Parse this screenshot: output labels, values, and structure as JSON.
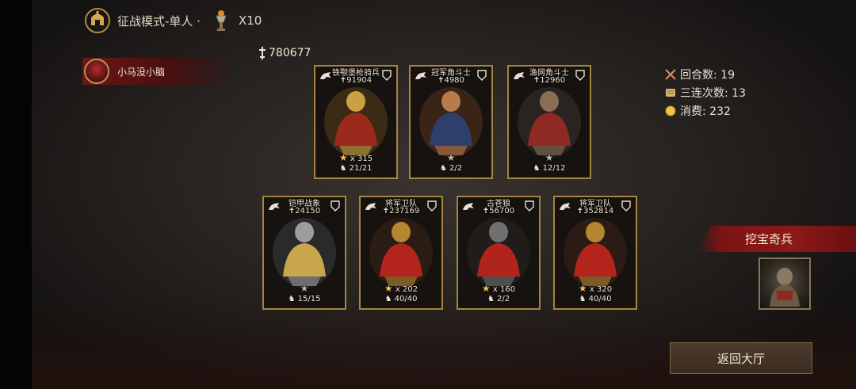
{
  "header": {
    "mode_label": "征战模式-单人 ·",
    "multiplier": "X10"
  },
  "player": {
    "name": "小马没小脑"
  },
  "total_power": "780677",
  "stats": {
    "rounds": "回合数: 19",
    "triple": "三连次数: 13",
    "cost": "消费: 232"
  },
  "cards": [
    {
      "name": "铁颚堡枪骑兵",
      "power": "91904",
      "stars": "x 315",
      "star_color": "gold",
      "troops": "21/21"
    },
    {
      "name": "冠军角斗士",
      "power": "4980",
      "stars": "",
      "star_color": "grey",
      "troops": "2/2"
    },
    {
      "name": "渔网角斗士",
      "power": "12960",
      "stars": "",
      "star_color": "grey",
      "troops": "12/12"
    },
    {
      "name": "铠甲战象",
      "power": "24150",
      "stars": "",
      "star_color": "grey",
      "troops": "15/15"
    },
    {
      "name": "将军卫队",
      "power": "237169",
      "stars": "x 202",
      "star_color": "gold",
      "troops": "40/40"
    },
    {
      "name": "古苍狼",
      "power": "56700",
      "stars": "x 160",
      "star_color": "gold",
      "troops": "2/2"
    },
    {
      "name": "将军卫队",
      "power": "352814",
      "stars": "x 320",
      "star_color": "gold",
      "troops": "40/40"
    }
  ],
  "treasure": {
    "label": "挖宝奇兵"
  },
  "return_button": {
    "label": "返回大厅"
  },
  "colors": {
    "gold_border": "#a6843f",
    "banner_red": "#8e1818",
    "star_gold": "#f1c24a"
  }
}
